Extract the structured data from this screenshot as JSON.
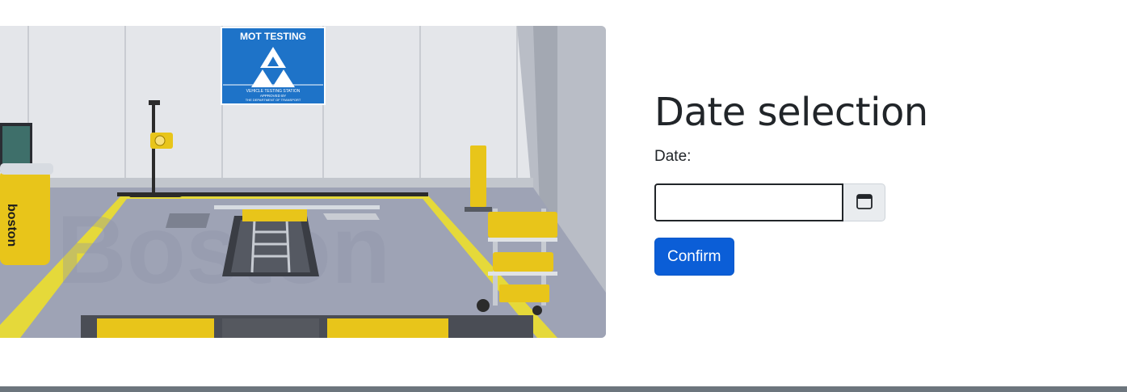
{
  "hero": {
    "alt": "MOT testing garage with vehicle inspection pit and Boston testing equipment",
    "sign_title": "MOT TESTING",
    "sign_line1": "VEHICLE TESTING STATION",
    "sign_line2": "APPROVED BY",
    "sign_line3": "THE DEPARTMENT OF TRANSPORT",
    "brand_text": "boston",
    "watermark_text": "Boston"
  },
  "form": {
    "title": "Date selection",
    "date_label": "Date:",
    "date_value": "",
    "confirm_label": "Confirm"
  },
  "colors": {
    "primary": "#0b5ed7",
    "footer": "#6c757d"
  },
  "icons": {
    "calendar": "calendar-icon"
  }
}
